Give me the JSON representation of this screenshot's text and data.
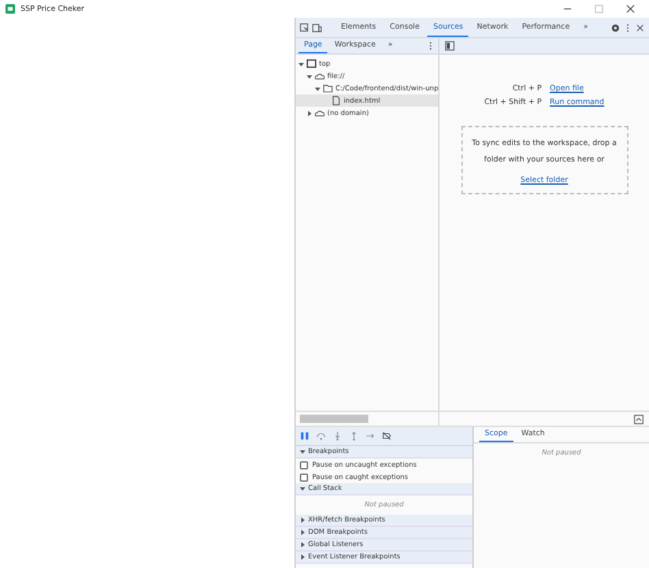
{
  "window": {
    "title": "SSP Price Cheker"
  },
  "devtools": {
    "tabs": [
      {
        "label": "Elements",
        "selected": false
      },
      {
        "label": "Console",
        "selected": false
      },
      {
        "label": "Sources",
        "selected": true
      },
      {
        "label": "Network",
        "selected": false
      },
      {
        "label": "Performance",
        "selected": false
      }
    ],
    "more": "»",
    "navigator_tabs": [
      {
        "label": "Page",
        "selected": true
      },
      {
        "label": "Workspace",
        "selected": false
      }
    ],
    "navigator_more": "»",
    "tree": [
      {
        "label": "top",
        "kind": "frame",
        "expanded": true,
        "selected": false,
        "children": [
          {
            "label": "file://",
            "kind": "cloud",
            "expanded": true,
            "selected": false,
            "children": [
              {
                "label": "C:/Code/frontend/dist/win-unp",
                "kind": "folder",
                "expanded": true,
                "selected": false,
                "children": [
                  {
                    "label": "index.html",
                    "kind": "file",
                    "selected": true
                  }
                ]
              }
            ]
          },
          {
            "label": "(no domain)",
            "kind": "cloud",
            "expanded": false,
            "selected": false
          }
        ]
      }
    ],
    "shortcuts": [
      {
        "keys": "Ctrl + P",
        "action": "Open file"
      },
      {
        "keys": "Ctrl + Shift + P",
        "action": "Run command"
      }
    ],
    "workspace_hint": "To sync edits to the workspace, drop a folder with your sources here or",
    "select_folder": "Select folder",
    "sections": [
      {
        "title": "Breakpoints",
        "expanded": true,
        "kind": "checks",
        "items": [
          {
            "label": "Pause on uncaught exceptions",
            "checked": false
          },
          {
            "label": "Pause on caught exceptions",
            "checked": false
          }
        ]
      },
      {
        "title": "Call Stack",
        "expanded": true,
        "kind": "message",
        "message": "Not paused"
      },
      {
        "title": "XHR/fetch Breakpoints",
        "expanded": false
      },
      {
        "title": "DOM Breakpoints",
        "expanded": false
      },
      {
        "title": "Global Listeners",
        "expanded": false
      },
      {
        "title": "Event Listener Breakpoints",
        "expanded": false
      }
    ],
    "scope_tabs": [
      {
        "label": "Scope",
        "selected": true
      },
      {
        "label": "Watch",
        "selected": false
      }
    ],
    "scope_message": "Not paused"
  }
}
